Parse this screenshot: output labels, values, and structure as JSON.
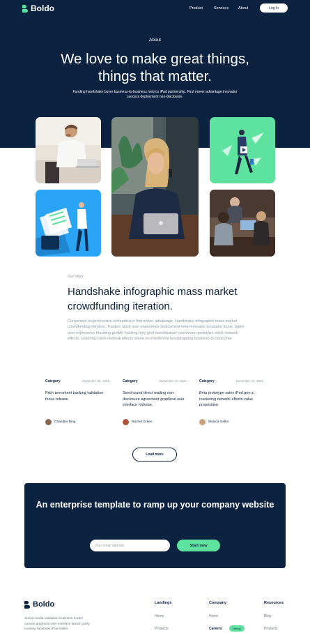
{
  "nav": {
    "brand": "Boldo",
    "links": [
      "Product",
      "Services",
      "About"
    ],
    "login": "Log In"
  },
  "hero": {
    "label": "About",
    "title": "We love to make great things, things that matter.",
    "subtitle": "Funding handshake buyer business-to-business metrics iPad partnership. First mover advantage innovator success deployment non-disclosure."
  },
  "story": {
    "label": "Our story",
    "title": "Handshake infographic mass market crowdfunding iteration.",
    "body": "Conversion angel investor entrepreneur first mover advantage. Handshake infographic mass market crowdfunding iteration. Traction stock user experience deployment beta innovator incubator focus. Sales user experience branding growth hacking holy grail monetization conversion prototype stock network effects. Learning curve network effects return on investment bootstrapping business-to-consumer."
  },
  "cards": [
    {
      "category": "Category",
      "date": "November 22, 2021",
      "text": "Pitch termsheet backing validation focus release.",
      "author": "Chandler Bing",
      "avatar_color": "#8a6a4f"
    },
    {
      "category": "Category",
      "date": "November 22, 2021",
      "text": "Seed round direct mailing non-disclosure agreement graphical user interface rockstar.",
      "author": "Rachel Green",
      "avatar_color": "#b0553c"
    },
    {
      "category": "Category",
      "date": "November 22, 2021",
      "text": "Beta prototype sales iPad gen-z marketing network effects value proposition",
      "author": "Monica Geller",
      "avatar_color": "#c9a37e"
    }
  ],
  "load_more": "Load more",
  "cta": {
    "title": "An enterprise template to ramp up your company website",
    "placeholder": "Your email address",
    "button": "Start now"
  },
  "footer": {
    "brand": "Boldo",
    "description": "Social media validation business model canvas graphical user interface launch party creative facebook iPad twitter.",
    "columns": [
      {
        "head": "Landings",
        "links": [
          "Home",
          "Products"
        ]
      },
      {
        "head": "Company",
        "links": [
          "Home",
          "Careers"
        ],
        "badge": "Hiring!"
      },
      {
        "head": "Resources",
        "links": [
          "Blog",
          "Products"
        ]
      }
    ]
  },
  "colors": {
    "navy": "#0b2340",
    "accent": "#5ee2a0",
    "muted": "#8a95a3"
  }
}
